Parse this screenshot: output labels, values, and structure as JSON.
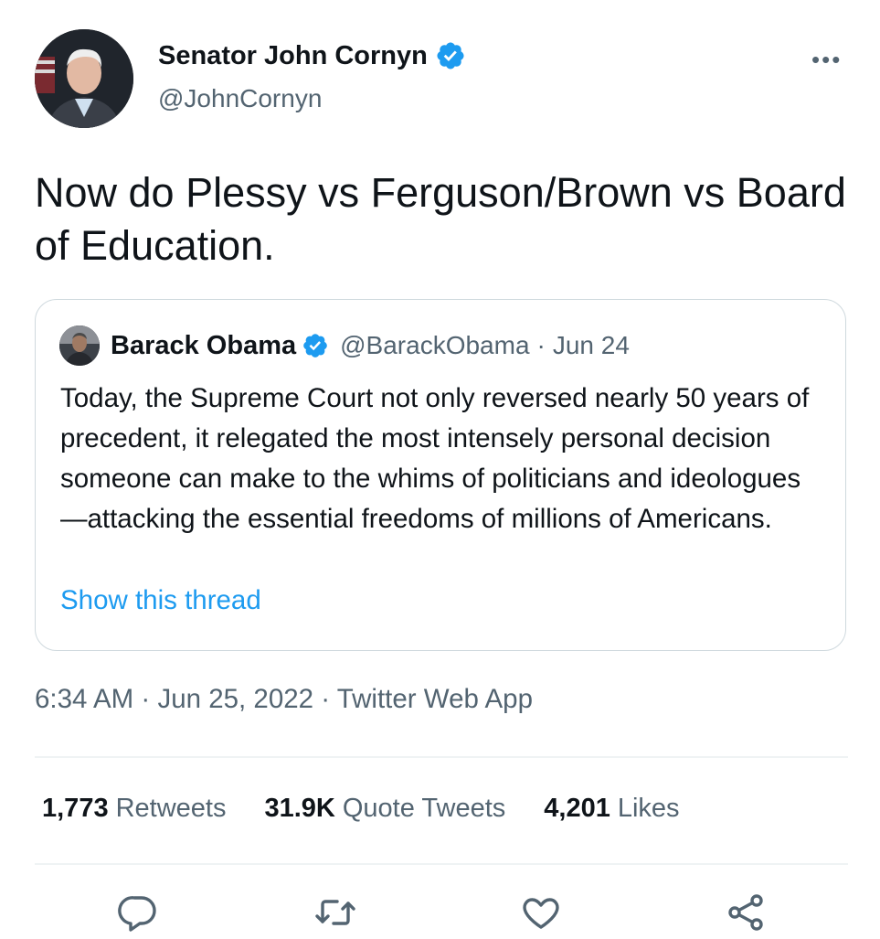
{
  "tweet": {
    "author_name": "Senator John Cornyn",
    "author_handle": "@JohnCornyn",
    "more_label": "•••",
    "text": "Now do Plessy vs Ferguson/Brown vs Board of Education.",
    "timestamp": "6:34 AM · Jun 25, 2022 · Twitter Web App"
  },
  "quoted": {
    "name": "Barack Obama",
    "handle": "@BarackObama",
    "separator": "·",
    "date": "Jun 24",
    "text": "Today, the Supreme Court not only reversed nearly 50 years of precedent, it relegated the most intensely personal decision someone can make to the whims of politicians and ideologues—attacking the essential freedoms of millions of Americans.",
    "show_thread": "Show this thread"
  },
  "stats": {
    "retweets_count": "1,773",
    "retweets_label": "Retweets",
    "quotes_count": "31.9K",
    "quotes_label": "Quote Tweets",
    "likes_count": "4,201",
    "likes_label": "Likes"
  },
  "icons": {
    "verified": "verified-badge-icon",
    "reply": "reply-icon",
    "retweet": "retweet-icon",
    "like": "heart-icon",
    "share": "share-icon"
  },
  "colors": {
    "accent": "#1d9bf0",
    "text": "#0f1419",
    "secondary": "#536471",
    "border": "#cfd9de"
  }
}
